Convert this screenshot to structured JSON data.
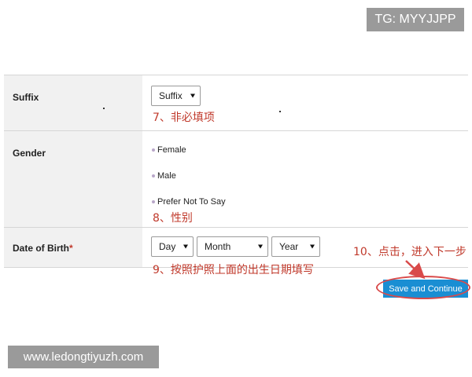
{
  "watermarks": {
    "top_right": "TG: MYYJJPP",
    "bottom_left": "www.ledongtiyuzh.com"
  },
  "form": {
    "suffix": {
      "label": "Suffix",
      "select_value": "Suffix"
    },
    "gender": {
      "label": "Gender",
      "options": [
        "Female",
        "Male",
        "Prefer Not To Say"
      ]
    },
    "dob": {
      "label": "Date of Birth",
      "required_mark": "*",
      "day_value": "Day",
      "month_value": "Month",
      "year_value": "Year"
    }
  },
  "annotations": {
    "step7": "7、非必填项",
    "step8": "8、性别",
    "step9": "9、按照护照上面的出生日期填写",
    "step10": "10、点击，进入下一步"
  },
  "actions": {
    "save_label": "Save and Continue"
  },
  "colors": {
    "annotation_red": "#c0392b",
    "button_blue": "#1a8ed3",
    "label_bg": "#f1f1f1"
  }
}
